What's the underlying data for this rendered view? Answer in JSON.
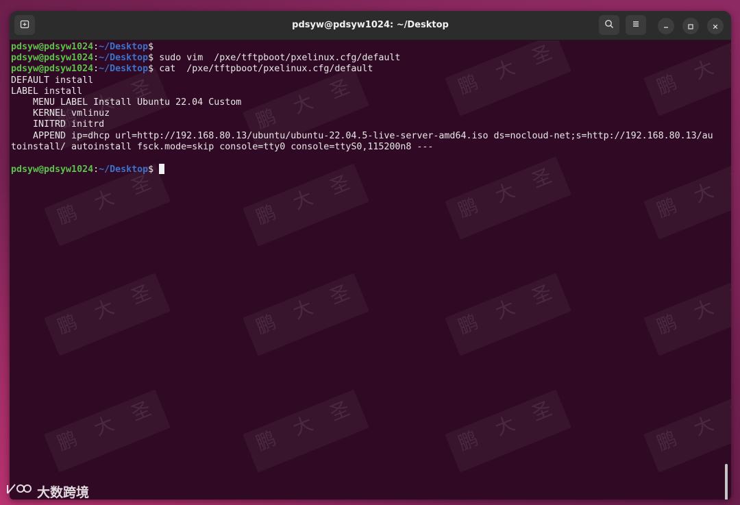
{
  "window": {
    "title": "pdsyw@pdsyw1024: ~/Desktop"
  },
  "titlebar_icons": {
    "new_tab": "new-tab-icon",
    "search": "search-icon",
    "menu": "hamburger-menu-icon",
    "minimize": "minimize-icon",
    "maximize": "maximize-icon",
    "close": "close-icon"
  },
  "terminal": {
    "lines": [
      {
        "kind": "prompt",
        "user": "pdsyw@pdsyw1024",
        "sep": ":",
        "path": "~/Desktop",
        "sign": "$",
        "command": ""
      },
      {
        "kind": "prompt",
        "user": "pdsyw@pdsyw1024",
        "sep": ":",
        "path": "~/Desktop",
        "sign": "$",
        "command": " sudo vim  /pxe/tftpboot/pxelinux.cfg/default"
      },
      {
        "kind": "prompt",
        "user": "pdsyw@pdsyw1024",
        "sep": ":",
        "path": "~/Desktop",
        "sign": "$",
        "command": " cat  /pxe/tftpboot/pxelinux.cfg/default"
      },
      {
        "kind": "output",
        "text": "DEFAULT install"
      },
      {
        "kind": "output",
        "text": "LABEL install"
      },
      {
        "kind": "output",
        "text": "    MENU LABEL Install Ubuntu 22.04 Custom"
      },
      {
        "kind": "output",
        "text": "    KERNEL vmlinuz"
      },
      {
        "kind": "output",
        "text": "    INITRD initrd"
      },
      {
        "kind": "output",
        "text": "    APPEND ip=dhcp url=http://192.168.80.13/ubuntu/ubuntu-22.04.5-live-server-amd64.iso ds=nocloud-net;s=http://192.168.80.13/au"
      },
      {
        "kind": "output",
        "text": "toinstall/ autoinstall fsck.mode=skip console=tty0 console=ttyS0,115200n8 ---"
      },
      {
        "kind": "output",
        "text": ""
      },
      {
        "kind": "prompt",
        "user": "pdsyw@pdsyw1024",
        "sep": ":",
        "path": "~/Desktop",
        "sign": "$",
        "command": " ",
        "cursor": true
      }
    ]
  },
  "watermark": {
    "chars": [
      "鹏",
      "大",
      "圣"
    ]
  },
  "corner_logo": {
    "text": "大数跨境"
  },
  "colors": {
    "terminal_bg": "#300a24",
    "prompt_user": "#5cc24a",
    "prompt_path": "#3d72c8",
    "text": "#e8e8e8",
    "titlebar": "#2c2c2c"
  }
}
